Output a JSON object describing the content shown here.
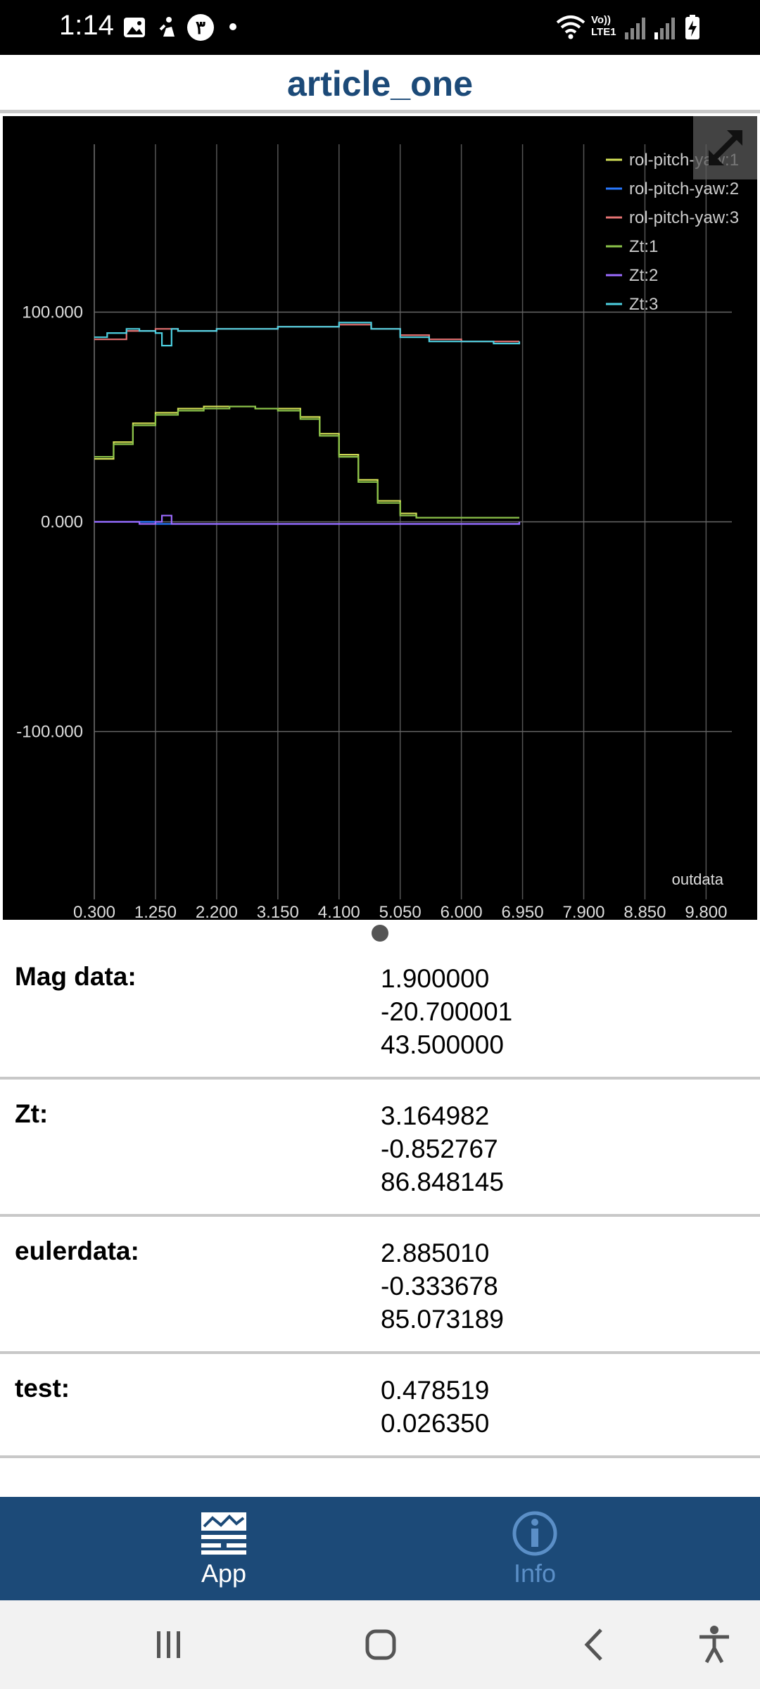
{
  "status_bar": {
    "time": "1:14",
    "icons": [
      "gallery-icon",
      "accessibility-icon",
      "notification-badge-icon",
      "dot-icon",
      "wifi-icon",
      "volte-icon",
      "signal-icon",
      "signal-icon-2",
      "battery-charging-icon"
    ],
    "badge_text": "٣",
    "volte_text": "Vo))\nLTE1"
  },
  "header": {
    "title": "article_one"
  },
  "chart_data": {
    "type": "line",
    "background": "#000000",
    "x_ticks": [
      "0.300",
      "1.250",
      "2.200",
      "3.150",
      "4.100",
      "5.050",
      "6.000",
      "6.950",
      "7.900",
      "8.850",
      "9.800"
    ],
    "y_ticks": [
      "100.000",
      "0.000",
      "-100.000"
    ],
    "xlim": [
      0.3,
      10.2
    ],
    "ylim": [
      -180,
      180
    ],
    "grid": true,
    "legend_position": "top-right",
    "annotation": "outdata",
    "series": [
      {
        "name": "rol-pitch-yaw:1",
        "color": "#d4e157",
        "x": [
          0.3,
          0.6,
          0.9,
          1.25,
          1.6,
          2.0,
          2.4,
          2.8,
          3.15,
          3.5,
          3.8,
          4.1,
          4.4,
          4.7,
          5.05,
          5.3,
          5.6,
          6.0,
          6.5,
          6.9
        ],
        "y": [
          30,
          38,
          47,
          52,
          54,
          55,
          55,
          54,
          54,
          50,
          42,
          32,
          20,
          10,
          4,
          2,
          2,
          2,
          2,
          2
        ]
      },
      {
        "name": "rol-pitch-yaw:2",
        "color": "#2979ff",
        "x": [
          0.3,
          1.25,
          2.2,
          3.15,
          4.1,
          5.05,
          6.0,
          6.9
        ],
        "y": [
          0,
          -1,
          -1,
          -1,
          -1,
          -1,
          -1,
          0
        ]
      },
      {
        "name": "rol-pitch-yaw:3",
        "color": "#e57373",
        "x": [
          0.3,
          0.8,
          1.25,
          1.6,
          2.2,
          3.15,
          4.1,
          4.6,
          5.05,
          5.5,
          6.0,
          6.5,
          6.9
        ],
        "y": [
          87,
          91,
          92,
          91,
          92,
          93,
          94,
          92,
          89,
          87,
          86,
          86,
          86
        ]
      },
      {
        "name": "Zt:1",
        "color": "#8bc34a",
        "x": [
          0.3,
          0.6,
          0.9,
          1.25,
          1.6,
          2.0,
          2.4,
          2.8,
          3.15,
          3.5,
          3.8,
          4.1,
          4.4,
          4.7,
          5.05,
          5.3,
          5.6,
          6.0,
          6.5,
          6.9
        ],
        "y": [
          31,
          37,
          46,
          51,
          53,
          54,
          55,
          54,
          53,
          49,
          41,
          31,
          19,
          9,
          3,
          2,
          2,
          2,
          2,
          2
        ]
      },
      {
        "name": "Zt:2",
        "color": "#9c6bff",
        "x": [
          0.3,
          1.0,
          1.25,
          1.35,
          1.5,
          2.2,
          3.15,
          4.1,
          5.05,
          6.0,
          6.9
        ],
        "y": [
          0,
          -1,
          0,
          3,
          -1,
          -1,
          -1,
          -1,
          -1,
          -1,
          0
        ]
      },
      {
        "name": "Zt:3",
        "color": "#4dd0e1",
        "x": [
          0.3,
          0.5,
          0.8,
          1.0,
          1.25,
          1.35,
          1.5,
          1.6,
          2.2,
          3.15,
          4.1,
          4.6,
          5.05,
          5.5,
          6.0,
          6.5,
          6.9
        ],
        "y": [
          88,
          90,
          92,
          91,
          90,
          84,
          92,
          91,
          92,
          93,
          95,
          92,
          88,
          86,
          86,
          85,
          86
        ]
      }
    ]
  },
  "rows": [
    {
      "label": "Mag data:",
      "values": [
        "1.900000",
        "-20.700001",
        "43.500000"
      ]
    },
    {
      "label": "Zt:",
      "values": [
        "3.164982",
        "-0.852767",
        "86.848145"
      ]
    },
    {
      "label": "eulerdata:",
      "values": [
        "2.885010",
        "-0.333678",
        "85.073189"
      ]
    },
    {
      "label": "test:",
      "values": [
        "0.478519",
        "0.026350"
      ]
    }
  ],
  "bottom_nav": {
    "items": [
      {
        "label": "App",
        "icon": "app-icon",
        "active": true
      },
      {
        "label": "Info",
        "icon": "info-icon",
        "active": false
      }
    ],
    "active_color": "#ffffff",
    "inactive_color": "#5b8fc7"
  },
  "system_nav": {
    "icons": [
      "recents-icon",
      "home-icon",
      "back-icon",
      "accessibility-icon"
    ]
  }
}
